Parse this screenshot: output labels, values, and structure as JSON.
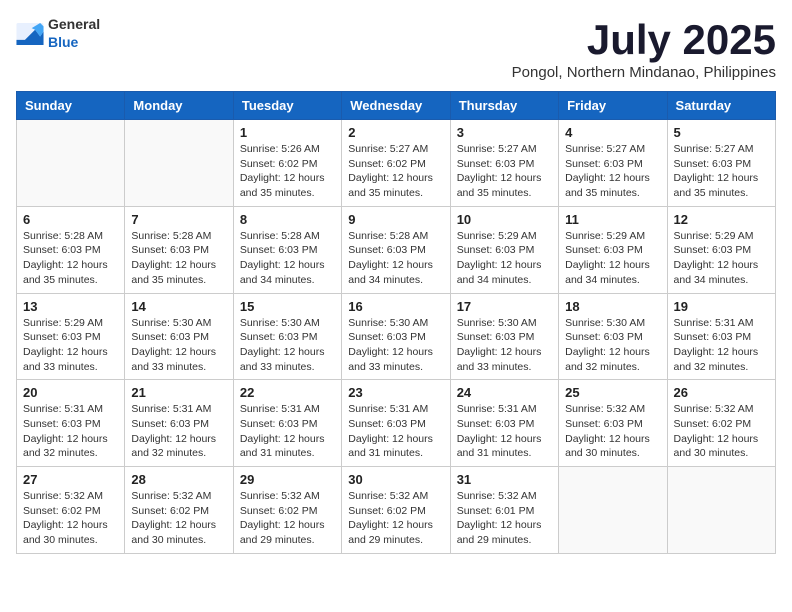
{
  "header": {
    "logo_general": "General",
    "logo_blue": "Blue",
    "title": "July 2025",
    "location": "Pongol, Northern Mindanao, Philippines"
  },
  "columns": [
    "Sunday",
    "Monday",
    "Tuesday",
    "Wednesday",
    "Thursday",
    "Friday",
    "Saturday"
  ],
  "weeks": [
    [
      {
        "day": "",
        "info": ""
      },
      {
        "day": "",
        "info": ""
      },
      {
        "day": "1",
        "info": "Sunrise: 5:26 AM\nSunset: 6:02 PM\nDaylight: 12 hours and 35 minutes."
      },
      {
        "day": "2",
        "info": "Sunrise: 5:27 AM\nSunset: 6:02 PM\nDaylight: 12 hours and 35 minutes."
      },
      {
        "day": "3",
        "info": "Sunrise: 5:27 AM\nSunset: 6:03 PM\nDaylight: 12 hours and 35 minutes."
      },
      {
        "day": "4",
        "info": "Sunrise: 5:27 AM\nSunset: 6:03 PM\nDaylight: 12 hours and 35 minutes."
      },
      {
        "day": "5",
        "info": "Sunrise: 5:27 AM\nSunset: 6:03 PM\nDaylight: 12 hours and 35 minutes."
      }
    ],
    [
      {
        "day": "6",
        "info": "Sunrise: 5:28 AM\nSunset: 6:03 PM\nDaylight: 12 hours and 35 minutes."
      },
      {
        "day": "7",
        "info": "Sunrise: 5:28 AM\nSunset: 6:03 PM\nDaylight: 12 hours and 35 minutes."
      },
      {
        "day": "8",
        "info": "Sunrise: 5:28 AM\nSunset: 6:03 PM\nDaylight: 12 hours and 34 minutes."
      },
      {
        "day": "9",
        "info": "Sunrise: 5:28 AM\nSunset: 6:03 PM\nDaylight: 12 hours and 34 minutes."
      },
      {
        "day": "10",
        "info": "Sunrise: 5:29 AM\nSunset: 6:03 PM\nDaylight: 12 hours and 34 minutes."
      },
      {
        "day": "11",
        "info": "Sunrise: 5:29 AM\nSunset: 6:03 PM\nDaylight: 12 hours and 34 minutes."
      },
      {
        "day": "12",
        "info": "Sunrise: 5:29 AM\nSunset: 6:03 PM\nDaylight: 12 hours and 34 minutes."
      }
    ],
    [
      {
        "day": "13",
        "info": "Sunrise: 5:29 AM\nSunset: 6:03 PM\nDaylight: 12 hours and 33 minutes."
      },
      {
        "day": "14",
        "info": "Sunrise: 5:30 AM\nSunset: 6:03 PM\nDaylight: 12 hours and 33 minutes."
      },
      {
        "day": "15",
        "info": "Sunrise: 5:30 AM\nSunset: 6:03 PM\nDaylight: 12 hours and 33 minutes."
      },
      {
        "day": "16",
        "info": "Sunrise: 5:30 AM\nSunset: 6:03 PM\nDaylight: 12 hours and 33 minutes."
      },
      {
        "day": "17",
        "info": "Sunrise: 5:30 AM\nSunset: 6:03 PM\nDaylight: 12 hours and 33 minutes."
      },
      {
        "day": "18",
        "info": "Sunrise: 5:30 AM\nSunset: 6:03 PM\nDaylight: 12 hours and 32 minutes."
      },
      {
        "day": "19",
        "info": "Sunrise: 5:31 AM\nSunset: 6:03 PM\nDaylight: 12 hours and 32 minutes."
      }
    ],
    [
      {
        "day": "20",
        "info": "Sunrise: 5:31 AM\nSunset: 6:03 PM\nDaylight: 12 hours and 32 minutes."
      },
      {
        "day": "21",
        "info": "Sunrise: 5:31 AM\nSunset: 6:03 PM\nDaylight: 12 hours and 32 minutes."
      },
      {
        "day": "22",
        "info": "Sunrise: 5:31 AM\nSunset: 6:03 PM\nDaylight: 12 hours and 31 minutes."
      },
      {
        "day": "23",
        "info": "Sunrise: 5:31 AM\nSunset: 6:03 PM\nDaylight: 12 hours and 31 minutes."
      },
      {
        "day": "24",
        "info": "Sunrise: 5:31 AM\nSunset: 6:03 PM\nDaylight: 12 hours and 31 minutes."
      },
      {
        "day": "25",
        "info": "Sunrise: 5:32 AM\nSunset: 6:03 PM\nDaylight: 12 hours and 30 minutes."
      },
      {
        "day": "26",
        "info": "Sunrise: 5:32 AM\nSunset: 6:02 PM\nDaylight: 12 hours and 30 minutes."
      }
    ],
    [
      {
        "day": "27",
        "info": "Sunrise: 5:32 AM\nSunset: 6:02 PM\nDaylight: 12 hours and 30 minutes."
      },
      {
        "day": "28",
        "info": "Sunrise: 5:32 AM\nSunset: 6:02 PM\nDaylight: 12 hours and 30 minutes."
      },
      {
        "day": "29",
        "info": "Sunrise: 5:32 AM\nSunset: 6:02 PM\nDaylight: 12 hours and 29 minutes."
      },
      {
        "day": "30",
        "info": "Sunrise: 5:32 AM\nSunset: 6:02 PM\nDaylight: 12 hours and 29 minutes."
      },
      {
        "day": "31",
        "info": "Sunrise: 5:32 AM\nSunset: 6:01 PM\nDaylight: 12 hours and 29 minutes."
      },
      {
        "day": "",
        "info": ""
      },
      {
        "day": "",
        "info": ""
      }
    ]
  ]
}
